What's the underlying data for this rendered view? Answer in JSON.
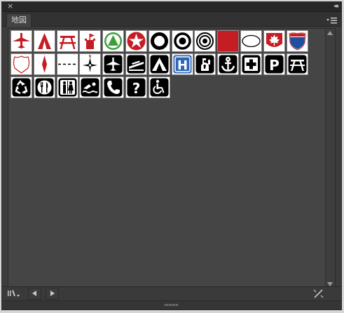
{
  "panel": {
    "tab_label": "地図",
    "close_glyph": "×",
    "collapse_glyph": "◂◂"
  },
  "symbols": [
    {
      "name": "airplane-red-icon"
    },
    {
      "name": "tent-red-icon"
    },
    {
      "name": "picnic-table-red-icon"
    },
    {
      "name": "castle-red-icon"
    },
    {
      "name": "triangle-green-circle-icon"
    },
    {
      "name": "star-red-circle-icon"
    },
    {
      "name": "ring-thick-icon"
    },
    {
      "name": "ring-dot-icon"
    },
    {
      "name": "double-ring-icon"
    },
    {
      "name": "red-square-icon"
    },
    {
      "name": "white-oval-icon"
    },
    {
      "name": "maple-leaf-shield-icon"
    },
    {
      "name": "interstate-shield-icon"
    },
    {
      "name": "us-route-shield-icon"
    },
    {
      "name": "red-diamond-marker-icon"
    },
    {
      "name": "dashed-line-icon"
    },
    {
      "name": "compass-rose-icon"
    },
    {
      "name": "airport-icon"
    },
    {
      "name": "boat-ramp-icon"
    },
    {
      "name": "campground-icon"
    },
    {
      "name": "hospital-icon"
    },
    {
      "name": "drinking-water-icon"
    },
    {
      "name": "marina-anchor-icon"
    },
    {
      "name": "first-aid-icon"
    },
    {
      "name": "parking-icon"
    },
    {
      "name": "picnic-area-icon"
    },
    {
      "name": "recycling-icon"
    },
    {
      "name": "restaurant-icon"
    },
    {
      "name": "restroom-icon"
    },
    {
      "name": "swimming-icon"
    },
    {
      "name": "telephone-icon"
    },
    {
      "name": "information-icon"
    },
    {
      "name": "wheelchair-accessible-icon"
    }
  ],
  "footer": {
    "library_menu": "library-menu-icon",
    "prev": "previous-arrow-icon",
    "next": "next-arrow-icon",
    "break_link": "break-link-icon"
  }
}
